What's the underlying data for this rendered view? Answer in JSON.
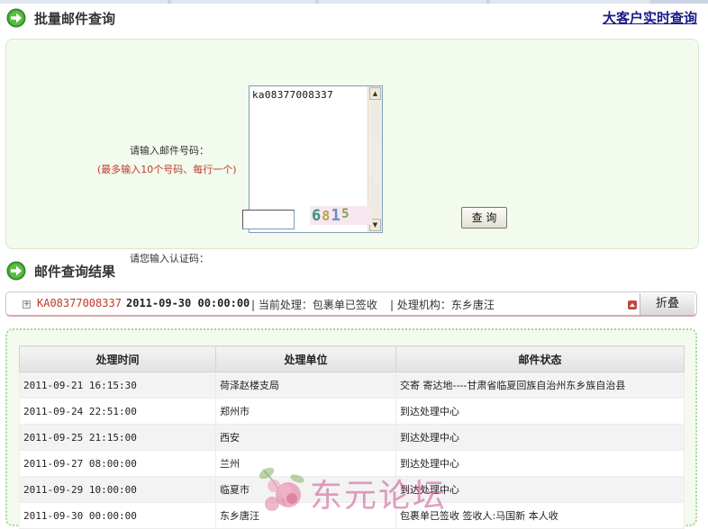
{
  "batch_section": {
    "title": "批量邮件查询",
    "big_customer_link": "大客户实时查询",
    "mail_label": "请输入邮件号码：",
    "mail_note": "(最多输入10个号码、每行一个)",
    "mail_textarea_value": "ka08377008337",
    "code_label": "请您输入认证码：",
    "code_input_value": "",
    "captcha": [
      "6",
      "8",
      "1",
      "5"
    ],
    "query_button": "查 询"
  },
  "result_section": {
    "title": "邮件查询结果",
    "summary": {
      "tracking": "KA08377008337",
      "datetime": "2011-09-30  00:00:00",
      "status": "| 当前处理：包裹单已签收",
      "org": "| 处理机构：东乡唐汪",
      "fold_button": "折叠"
    },
    "table": {
      "headers": [
        "处理时间",
        "处理单位",
        "邮件状态"
      ],
      "rows": [
        {
          "time": "2011-09-21 16:15:30",
          "unit": "荷泽赵楼支局",
          "status": "交寄  寄达地----甘肃省临夏回族自治州东乡族自治县"
        },
        {
          "time": "2011-09-24 22:51:00",
          "unit": "郑州市",
          "status": "到达处理中心"
        },
        {
          "time": "2011-09-25 21:15:00",
          "unit": "西安",
          "status": "到达处理中心"
        },
        {
          "time": "2011-09-27 08:00:00",
          "unit": "兰州",
          "status": "到达处理中心"
        },
        {
          "time": "2011-09-29 10:00:00",
          "unit": "临夏市",
          "status": "到达处理中心"
        },
        {
          "time": "2011-09-30 00:00:00",
          "unit": "东乡唐汪",
          "status": "包裹单已签收  签收人:马国新 本人收"
        }
      ]
    }
  },
  "watermark": "东元论坛",
  "colors": {
    "panel_bg": "#f2fbee",
    "arrow_green": "#3f9f2f",
    "tracking_red": "#c0392b",
    "link_blue": "#1a1a8a"
  }
}
